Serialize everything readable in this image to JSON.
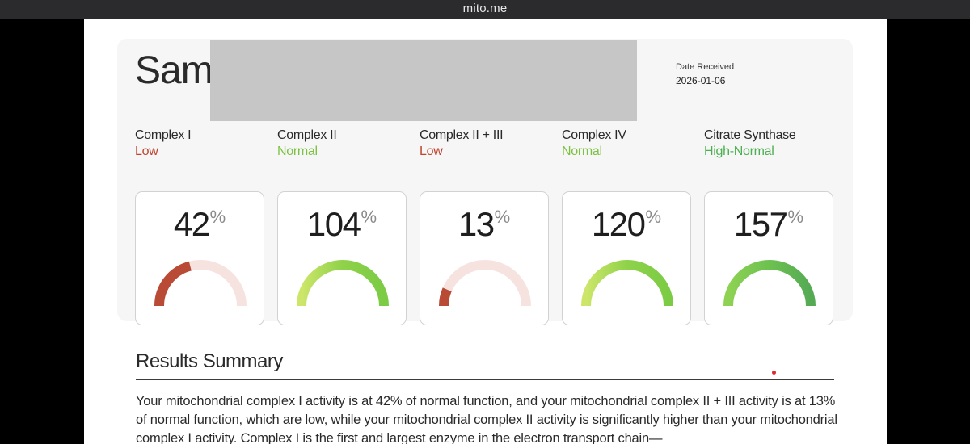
{
  "window": {
    "title": "mito.me"
  },
  "report": {
    "patient_name": "Sam",
    "date_label": "Date Received",
    "date_value": "2026-01-06"
  },
  "metrics": [
    {
      "name": "Complex I",
      "status": "Low",
      "status_color": "#c0432f",
      "value": "42",
      "unit": "%",
      "percent": 42,
      "arc_color": "#b94a35",
      "track_color": "#f6e3e0"
    },
    {
      "name": "Complex II",
      "status": "Normal",
      "status_color": "#7cc242",
      "value": "104",
      "unit": "%",
      "percent": 104,
      "arc_color": "gradient-yellowgreen",
      "track_color": "#f0f0f0"
    },
    {
      "name": "Complex II + III",
      "status": "Low",
      "status_color": "#c0432f",
      "value": "13",
      "unit": "%",
      "percent": 13,
      "arc_color": "#b94a35",
      "track_color": "#f6e3e0"
    },
    {
      "name": "Complex IV",
      "status": "Normal",
      "status_color": "#7cc242",
      "value": "120",
      "unit": "%",
      "percent": 120,
      "arc_color": "gradient-yellowgreen",
      "track_color": "#f0f0f0"
    },
    {
      "name": "Citrate Synthase",
      "status": "High-Normal",
      "status_color": "#4caf50",
      "value": "157",
      "unit": "%",
      "percent": 157,
      "arc_color": "gradient-green",
      "track_color": "#f0f0f0"
    }
  ],
  "summary": {
    "title": "Results Summary",
    "text": "Your mitochondrial complex I activity is at 42% of normal function, and your mitochondrial complex II + III activity is at 13% of normal function, which are low, while your mitochondrial complex II activity is significantly higher than your mitochondrial complex I activity. Complex I is the first and largest enzyme in the electron transport chain—"
  }
}
